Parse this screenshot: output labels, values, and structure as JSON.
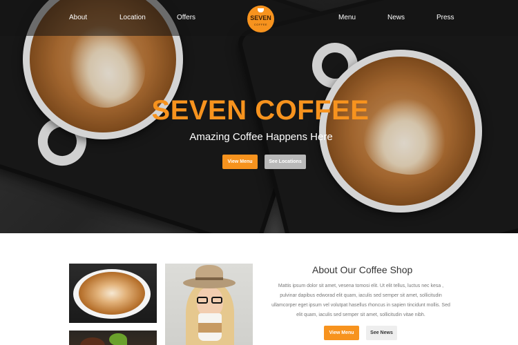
{
  "nav": {
    "items_left": [
      "About",
      "Location",
      "Offers"
    ],
    "items_right": [
      "Menu",
      "News",
      "Press"
    ],
    "logo": {
      "name": "SEVEN",
      "sub": "COFFEE"
    }
  },
  "hero": {
    "title": "SEVEN COFFEE",
    "tagline": "Amazing Coffee Happens Here",
    "buttons": {
      "primary": "View Menu",
      "secondary": "See Locations"
    }
  },
  "about": {
    "title": "About Our Coffee Shop",
    "text": "Mattis ipsum dolor sit amet, vesena tomosi elit. Ut elit tellus, luctus nec kesa , pulvinar dapibus edworad elit quam, iaculis sed semper sit amet, sollicitudin ullamcorper eget ipsum vel volutpat hasellus rhoncus in sapien tincidunt mollis. Sed elit quam, iaculis sed semper sit amet, sollicitudin vitae nibh.",
    "buttons": {
      "primary": "View Menu",
      "secondary": "See News"
    }
  },
  "colors": {
    "accent": "#f7931e",
    "dark_nav": "#141414",
    "text": "#333333",
    "muted": "#777777"
  }
}
